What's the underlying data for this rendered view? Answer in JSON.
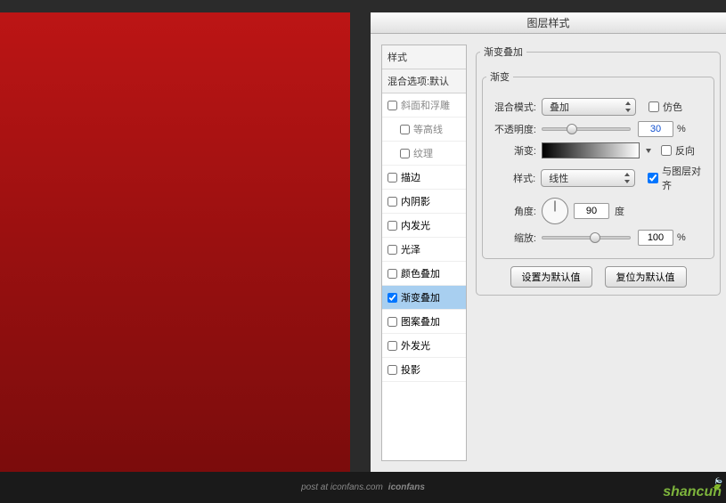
{
  "dialog": {
    "title": "图层样式"
  },
  "styles": {
    "header": "样式",
    "blendDefault": "混合选项:默认",
    "items": [
      {
        "label": "斜面和浮雕",
        "checked": false,
        "indent": false,
        "dis": true
      },
      {
        "label": "等高线",
        "checked": false,
        "indent": true,
        "dis": true
      },
      {
        "label": "纹理",
        "checked": false,
        "indent": true,
        "dis": true
      },
      {
        "label": "描边",
        "checked": false,
        "indent": false
      },
      {
        "label": "内阴影",
        "checked": false,
        "indent": false
      },
      {
        "label": "内发光",
        "checked": false,
        "indent": false
      },
      {
        "label": "光泽",
        "checked": false,
        "indent": false
      },
      {
        "label": "颜色叠加",
        "checked": false,
        "indent": false
      },
      {
        "label": "渐变叠加",
        "checked": true,
        "indent": false,
        "sel": true
      },
      {
        "label": "图案叠加",
        "checked": false,
        "indent": false
      },
      {
        "label": "外发光",
        "checked": false,
        "indent": false
      },
      {
        "label": "投影",
        "checked": false,
        "indent": false
      }
    ]
  },
  "overlay": {
    "groupLabel": "渐变叠加",
    "innerGroupLabel": "渐变",
    "blendMode": {
      "label": "混合模式:",
      "value": "叠加"
    },
    "dither": {
      "label": "仿色",
      "checked": false
    },
    "opacity": {
      "label": "不透明度:",
      "value": "30",
      "unit": "%",
      "pos": 30
    },
    "gradient": {
      "label": "渐变:"
    },
    "reverse": {
      "label": "反向",
      "checked": false
    },
    "style": {
      "label": "样式:",
      "value": "线性"
    },
    "align": {
      "label": "与图层对齐",
      "checked": true
    },
    "angle": {
      "label": "角度:",
      "value": "90",
      "unit": "度"
    },
    "scale": {
      "label": "缩放:",
      "value": "100",
      "unit": "%",
      "pos": 55
    }
  },
  "buttons": {
    "default": "设置为默认值",
    "reset": "复位为默认值"
  },
  "footer": {
    "text": "post at iconfans.com",
    "brand": "iconfans"
  },
  "watermark": "shancun"
}
